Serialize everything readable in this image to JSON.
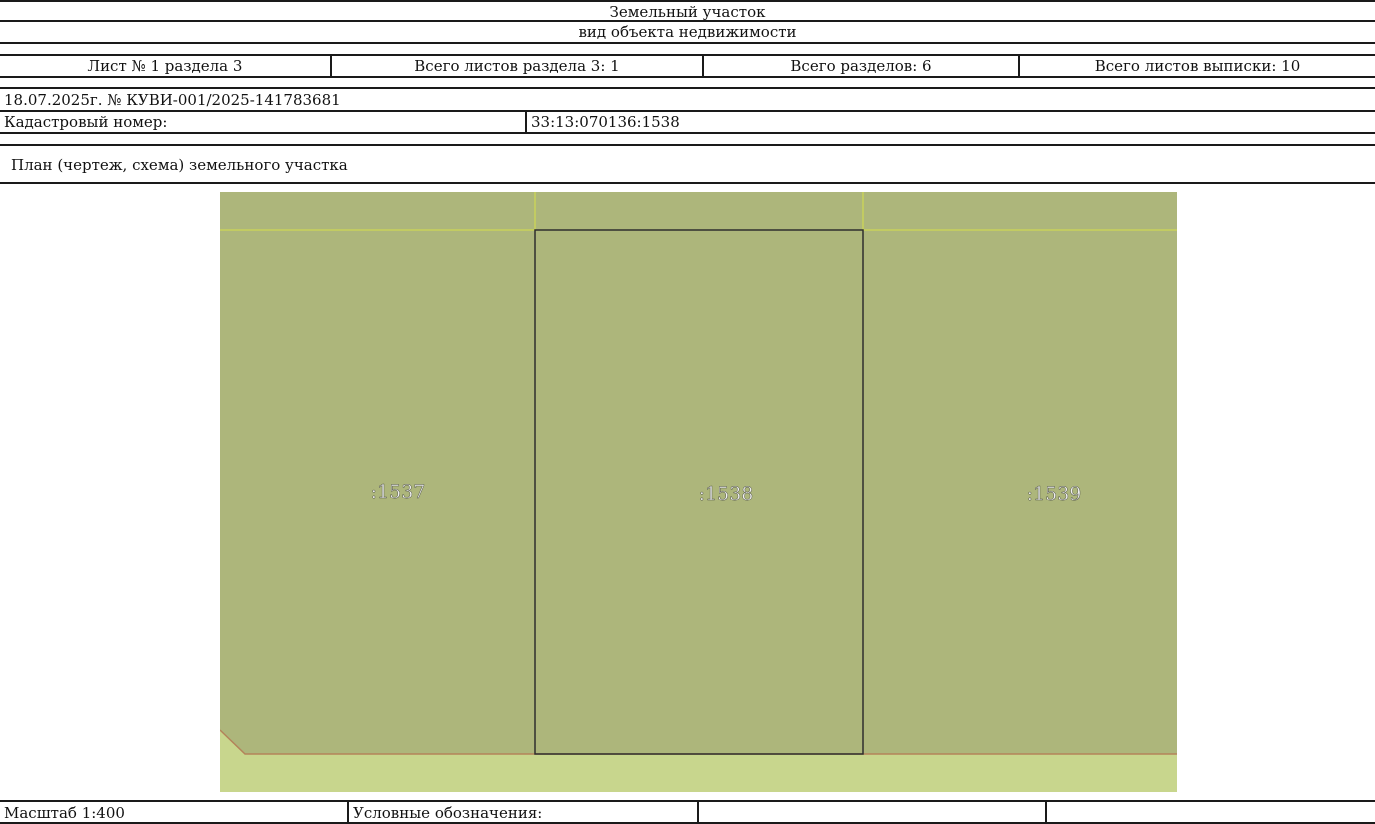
{
  "header": {
    "title": "Земельный участок",
    "subtitle": "вид объекта недвижимости"
  },
  "sheet_info": {
    "sheet_no": "Лист № 1 раздела 3",
    "section_sheets": "Всего листов раздела 3: 1",
    "total_sections": "Всего разделов: 6",
    "total_sheets": "Всего листов выписки: 10"
  },
  "document": {
    "date_number": "18.07.2025г. № КУВИ-001/2025-141783681",
    "cadastral_label": "Кадастровый номер:",
    "cadastral_value": "33:13:070136:1538"
  },
  "plan": {
    "title": "План (чертеж, схема) земельного участка",
    "parcels": [
      {
        "label": ":1537"
      },
      {
        "label": ":1538"
      },
      {
        "label": ":1539"
      }
    ],
    "colors": {
      "parcel_fill": "#adb67b",
      "road_fill": "#c8d68d",
      "grid_line": "#d6e04a",
      "boundary": "#2e2e2e",
      "road_edge": "#b4835a",
      "label": "#f1f1f1"
    }
  },
  "footer": {
    "scale": "Масштаб 1:400",
    "legend_label": "Условные обозначения:"
  }
}
